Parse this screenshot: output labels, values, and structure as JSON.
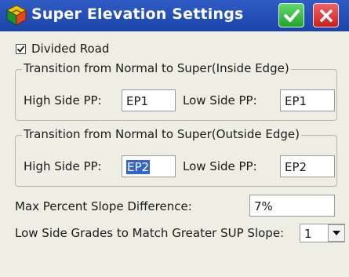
{
  "window": {
    "title": "Super Elevation Settings",
    "icons": {
      "app": "road-sign-icon",
      "ok": "check-icon",
      "close": "close-icon"
    },
    "colors": {
      "titlebar": "#1f4bb0",
      "ok": "#2db136",
      "close": "#d92a2a",
      "background": "#efeee4",
      "selection": "#3366cc"
    }
  },
  "divided_road": {
    "label": "Divided Road",
    "checked": true
  },
  "inside_group": {
    "legend": "Transition from Normal to Super(Inside Edge)",
    "high_label": "High Side PP:",
    "high_value": "EP1",
    "low_label": "Low Side PP:",
    "low_value": "EP1"
  },
  "outside_group": {
    "legend": "Transition from Normal to Super(Outside Edge)",
    "high_label": "High Side PP:",
    "high_value": "EP2",
    "low_label": "Low Side PP:",
    "low_value": "EP2"
  },
  "max_slope": {
    "label": "Max Percent Slope Difference:",
    "value": "7%"
  },
  "low_side_grades": {
    "label": "Low Side Grades to Match Greater SUP Slope:",
    "value": "1"
  }
}
